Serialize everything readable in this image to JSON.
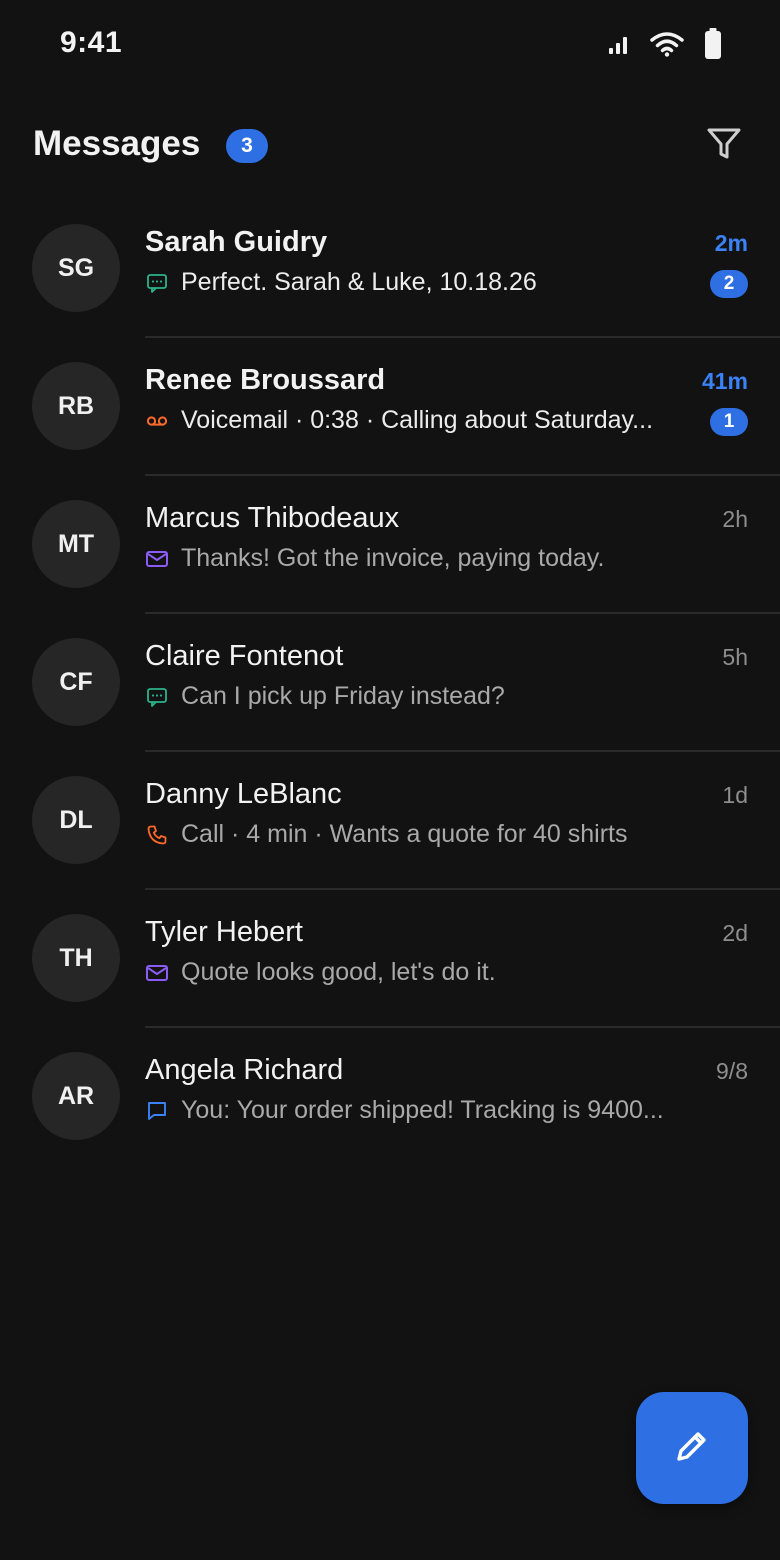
{
  "status_bar": {
    "time": "9:41",
    "icons": [
      "signal-icon",
      "wifi-icon",
      "battery-icon"
    ]
  },
  "header": {
    "title": "Messages",
    "unread_count": "3",
    "filter_icon": "filter-icon"
  },
  "colors": {
    "background": "#121212",
    "accent": "#2f6fe4",
    "sms": "#2bb38a",
    "voicemail": "#ff6a2b",
    "email": "#8b5cf6",
    "call": "#ff6a2b",
    "chat": "#3b82f6"
  },
  "conversations": [
    {
      "initials": "SG",
      "name": "Sarah Guidry",
      "time": "2m",
      "type": "sms",
      "preview": "Perfect. Sarah & Luke, 10.18.26",
      "unread_count": "2"
    },
    {
      "initials": "RB",
      "name": "Renee Broussard",
      "time": "41m",
      "type": "voicemail",
      "preview": "Voicemail · 0:38 · Calling about Saturday...",
      "unread_count": "1"
    },
    {
      "initials": "MT",
      "name": "Marcus Thibodeaux",
      "time": "2h",
      "type": "email",
      "preview": "Thanks! Got the invoice, paying today.",
      "unread_count": ""
    },
    {
      "initials": "CF",
      "name": "Claire Fontenot",
      "time": "5h",
      "type": "sms",
      "preview": "Can I pick up Friday instead?",
      "unread_count": ""
    },
    {
      "initials": "DL",
      "name": "Danny LeBlanc",
      "time": "1d",
      "type": "call",
      "preview": "Call · 4 min · Wants a quote for 40 shirts",
      "unread_count": ""
    },
    {
      "initials": "TH",
      "name": "Tyler Hebert",
      "time": "2d",
      "type": "email",
      "preview": "Quote looks good, let's do it.",
      "unread_count": ""
    },
    {
      "initials": "AR",
      "name": "Angela Richard",
      "time": "9/8",
      "type": "chat",
      "preview": "You: Your order shipped! Tracking is 9400...",
      "unread_count": ""
    }
  ],
  "fab": {
    "icon": "pencil-icon"
  }
}
